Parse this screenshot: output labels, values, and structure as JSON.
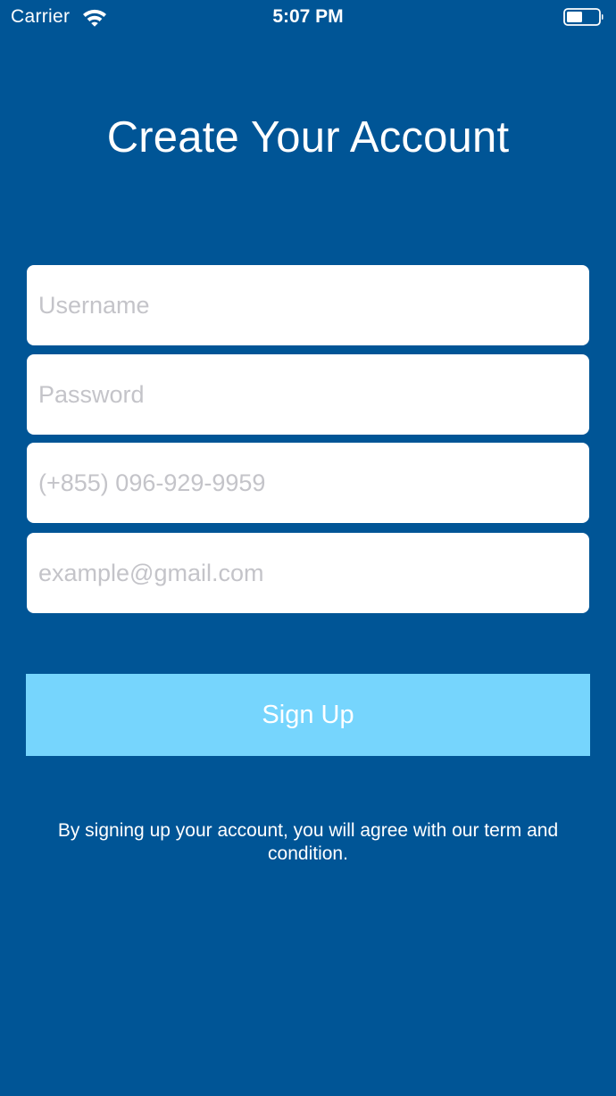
{
  "status_bar": {
    "carrier": "Carrier",
    "time": "5:07 PM",
    "wifi_icon": "wifi-icon",
    "battery_icon": "battery-icon"
  },
  "title": "Create Your Account",
  "form": {
    "username": {
      "value": "",
      "placeholder": "Username"
    },
    "password": {
      "value": "",
      "placeholder": "Password"
    },
    "phone": {
      "value": "",
      "placeholder": "(+855) 096-929-9959"
    },
    "email": {
      "value": "",
      "placeholder": "example@gmail.com"
    }
  },
  "signup_button": {
    "label": "Sign Up"
  },
  "terms_text": "By signing up your account, you will agree with our term and condition.",
  "colors": {
    "background": "#005596",
    "button": "#76d5fd",
    "field": "#ffffff",
    "placeholder": "#c4c4c9"
  }
}
